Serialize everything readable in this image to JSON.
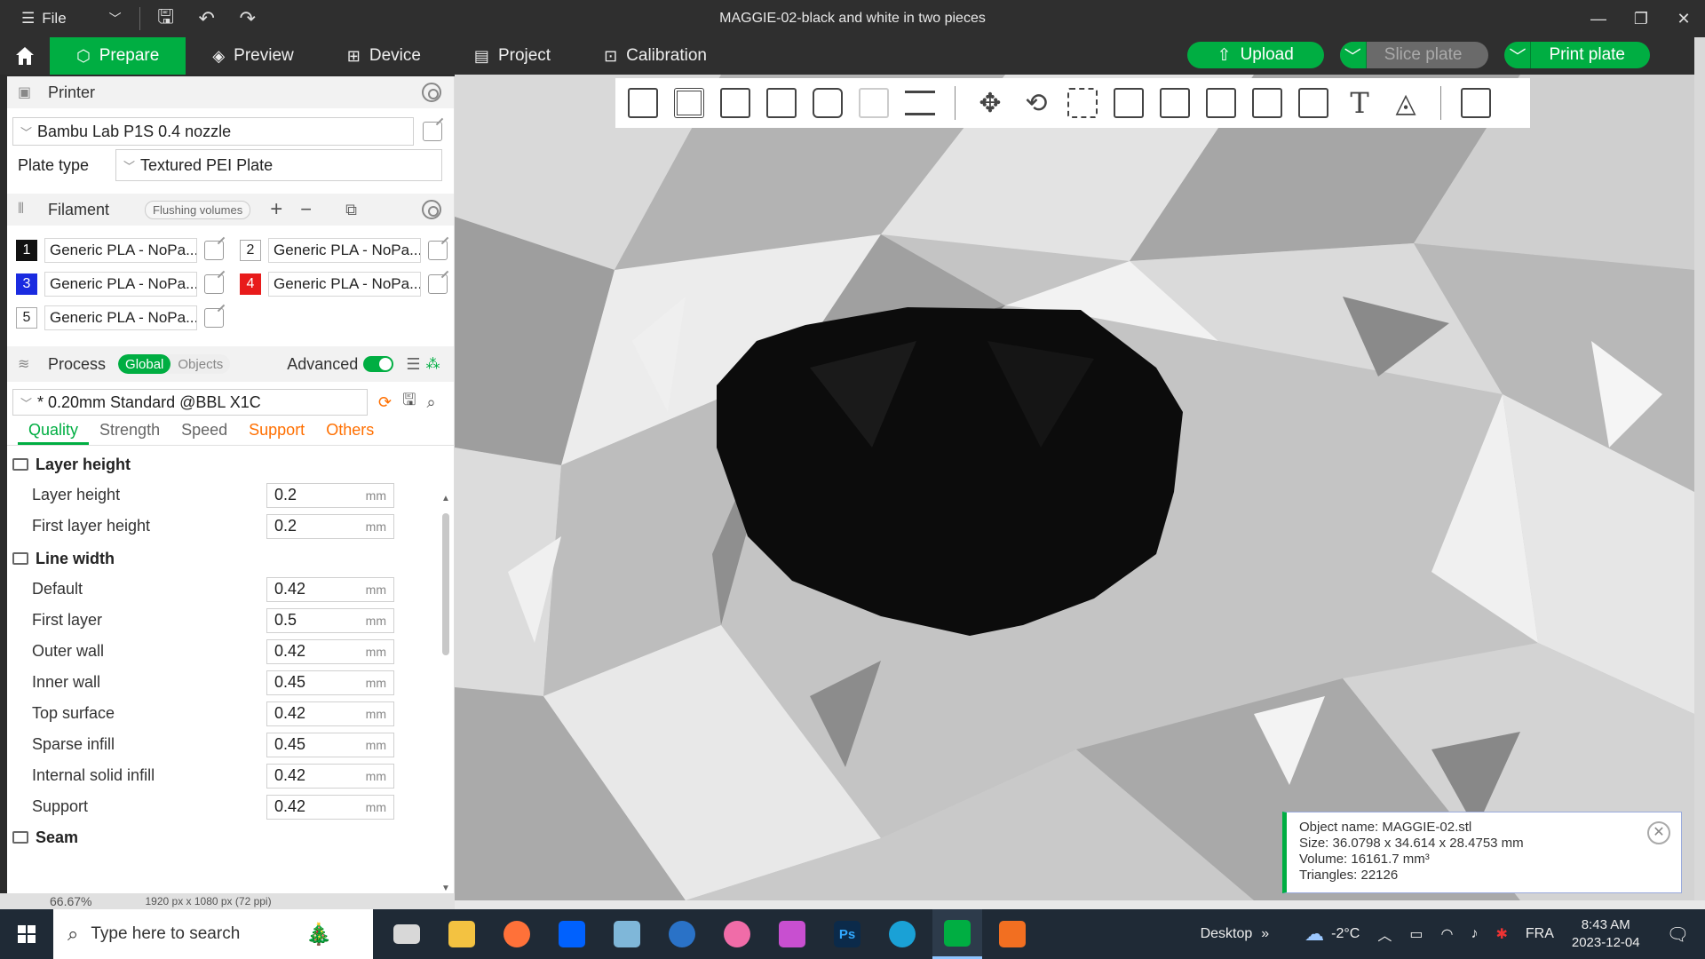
{
  "window": {
    "title": "MAGGIE-02-black and white in two pieces",
    "file_label": "File"
  },
  "nav": {
    "tabs": [
      {
        "label": "Prepare",
        "icon": "cube-icon"
      },
      {
        "label": "Preview",
        "icon": "layers-icon"
      },
      {
        "label": "Device",
        "icon": "device-icon"
      },
      {
        "label": "Project",
        "icon": "list-icon"
      },
      {
        "label": "Calibration",
        "icon": "calibration-icon"
      }
    ],
    "upload": "Upload",
    "slice": "Slice plate",
    "print": "Print plate"
  },
  "printer": {
    "header": "Printer",
    "name": "Bambu Lab P1S 0.4 nozzle",
    "plate_label": "Plate type",
    "plate_value": "Textured PEI Plate"
  },
  "filament": {
    "header": "Filament",
    "flushing": "Flushing volumes",
    "items": [
      {
        "num": "1",
        "name": "Generic PLA - NoPa...",
        "color": "#111111"
      },
      {
        "num": "2",
        "name": "Generic PLA - NoPa...",
        "color": "#ffffff"
      },
      {
        "num": "3",
        "name": "Generic PLA - NoPa...",
        "color": "#1a2be0"
      },
      {
        "num": "4",
        "name": "Generic PLA - NoPa...",
        "color": "#e81b1b"
      },
      {
        "num": "5",
        "name": "Generic PLA - NoPa...",
        "color": "#ffffff"
      }
    ]
  },
  "process": {
    "header": "Process",
    "global": "Global",
    "objects": "Objects",
    "advanced": "Advanced",
    "preset": "* 0.20mm Standard @BBL X1C",
    "tabs": [
      "Quality",
      "Strength",
      "Speed",
      "Support",
      "Others"
    ],
    "groups": {
      "layer_height": {
        "title": "Layer height",
        "params": [
          {
            "label": "Layer height",
            "value": "0.2",
            "unit": "mm"
          },
          {
            "label": "First layer height",
            "value": "0.2",
            "unit": "mm"
          }
        ]
      },
      "line_width": {
        "title": "Line width",
        "params": [
          {
            "label": "Default",
            "value": "0.42",
            "unit": "mm"
          },
          {
            "label": "First layer",
            "value": "0.5",
            "unit": "mm"
          },
          {
            "label": "Outer wall",
            "value": "0.42",
            "unit": "mm"
          },
          {
            "label": "Inner wall",
            "value": "0.45",
            "unit": "mm"
          },
          {
            "label": "Top surface",
            "value": "0.42",
            "unit": "mm"
          },
          {
            "label": "Sparse infill",
            "value": "0.45",
            "unit": "mm"
          },
          {
            "label": "Internal solid infill",
            "value": "0.42",
            "unit": "mm"
          },
          {
            "label": "Support",
            "value": "0.42",
            "unit": "mm"
          }
        ]
      },
      "seam": {
        "title": "Seam"
      }
    }
  },
  "status": {
    "zoom": "66.67%",
    "dims": "1920 px x 1080 px (72 ppi)"
  },
  "object_info": {
    "name": "Object name: MAGGIE-02.stl",
    "size": "Size: 36.0798 x 34.614 x 28.4753 mm",
    "volume": "Volume: 16161.7 mm³",
    "triangles": "Triangles: 22126"
  },
  "taskbar": {
    "search_placeholder": "Type here to search",
    "desktop": "Desktop",
    "temp": "-2°C",
    "lang": "FRA",
    "time": "8:43 AM",
    "date": "2023-12-04"
  },
  "colors": {
    "accent": "#00ae42",
    "warn": "#ff6f00"
  }
}
